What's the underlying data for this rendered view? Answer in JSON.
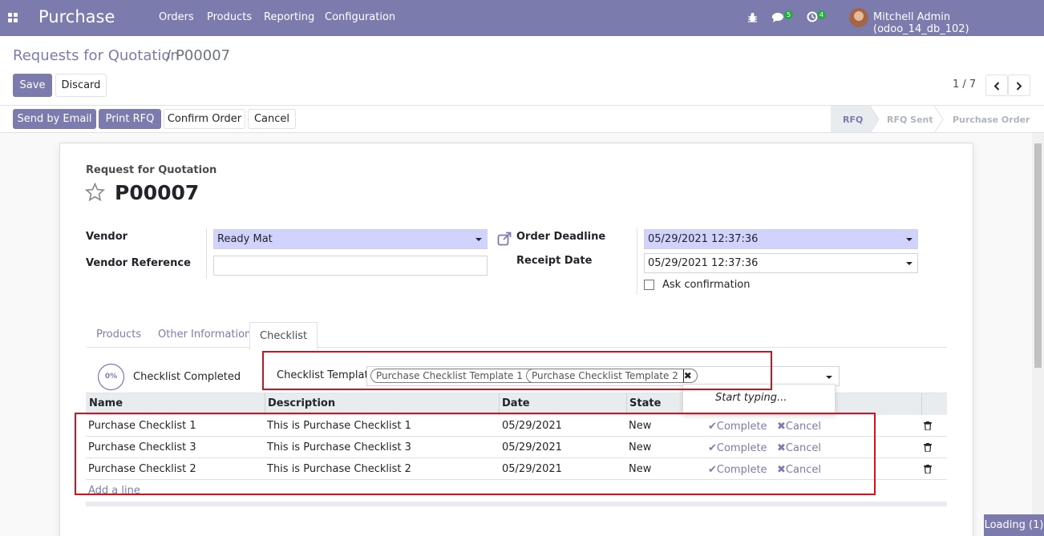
{
  "app": {
    "title": "Purchase"
  },
  "menu": [
    "Orders",
    "Products",
    "Reporting",
    "Configuration"
  ],
  "systray": {
    "messages_count": "5",
    "activities_count": "4",
    "user": "Mitchell Admin (odoo_14_db_102)"
  },
  "breadcrumb": {
    "parent": "Requests for Quotation",
    "separator": "/",
    "current": "P00007"
  },
  "controls": {
    "save": "Save",
    "discard": "Discard"
  },
  "pager": {
    "value": "1 / 7"
  },
  "header_buttons": {
    "send_email": "Send by Email",
    "print_rfq": "Print RFQ",
    "confirm": "Confirm Order",
    "cancel": "Cancel"
  },
  "statusbar": {
    "stages": [
      "RFQ",
      "RFQ Sent",
      "Purchase Order"
    ],
    "active": "RFQ"
  },
  "form": {
    "doc_type": "Request for Quotation",
    "doc_name": "P00007",
    "vendor_label": "Vendor",
    "vendor_value": "Ready Mat",
    "vendor_ref_label": "Vendor Reference",
    "vendor_ref_value": "",
    "order_deadline_label": "Order Deadline",
    "order_deadline_value": "05/29/2021 12:37:36",
    "receipt_date_label": "Receipt Date",
    "receipt_date_value": "05/29/2021 12:37:36",
    "ask_confirmation_label": "Ask confirmation",
    "ask_confirmation_checked": false
  },
  "tabs": [
    "Products",
    "Other Information",
    "Checklist"
  ],
  "active_tab": "Checklist",
  "checklist": {
    "progress": "0%",
    "progress_label": "Checklist Completed",
    "template_label": "Checklist Template",
    "templates": [
      "Purchase Checklist Template 1",
      "Purchase Checklist Template 2"
    ],
    "dropdown_hint": "Start typing...",
    "columns": [
      "Name",
      "Description",
      "Date",
      "State"
    ],
    "rows": [
      {
        "name": "Purchase Checklist 1",
        "description": "This is Purchase Checklist 1",
        "date": "05/29/2021",
        "state": "New"
      },
      {
        "name": "Purchase Checklist 3",
        "description": "This is Purchase Checklist 3",
        "date": "05/29/2021",
        "state": "New"
      },
      {
        "name": "Purchase Checklist 2",
        "description": "This is Purchase Checklist 2",
        "date": "05/29/2021",
        "state": "New"
      }
    ],
    "complete_label": "Complete",
    "cancel_label": "Cancel",
    "add_line": "Add a line"
  },
  "loading": "Loading (1)"
}
